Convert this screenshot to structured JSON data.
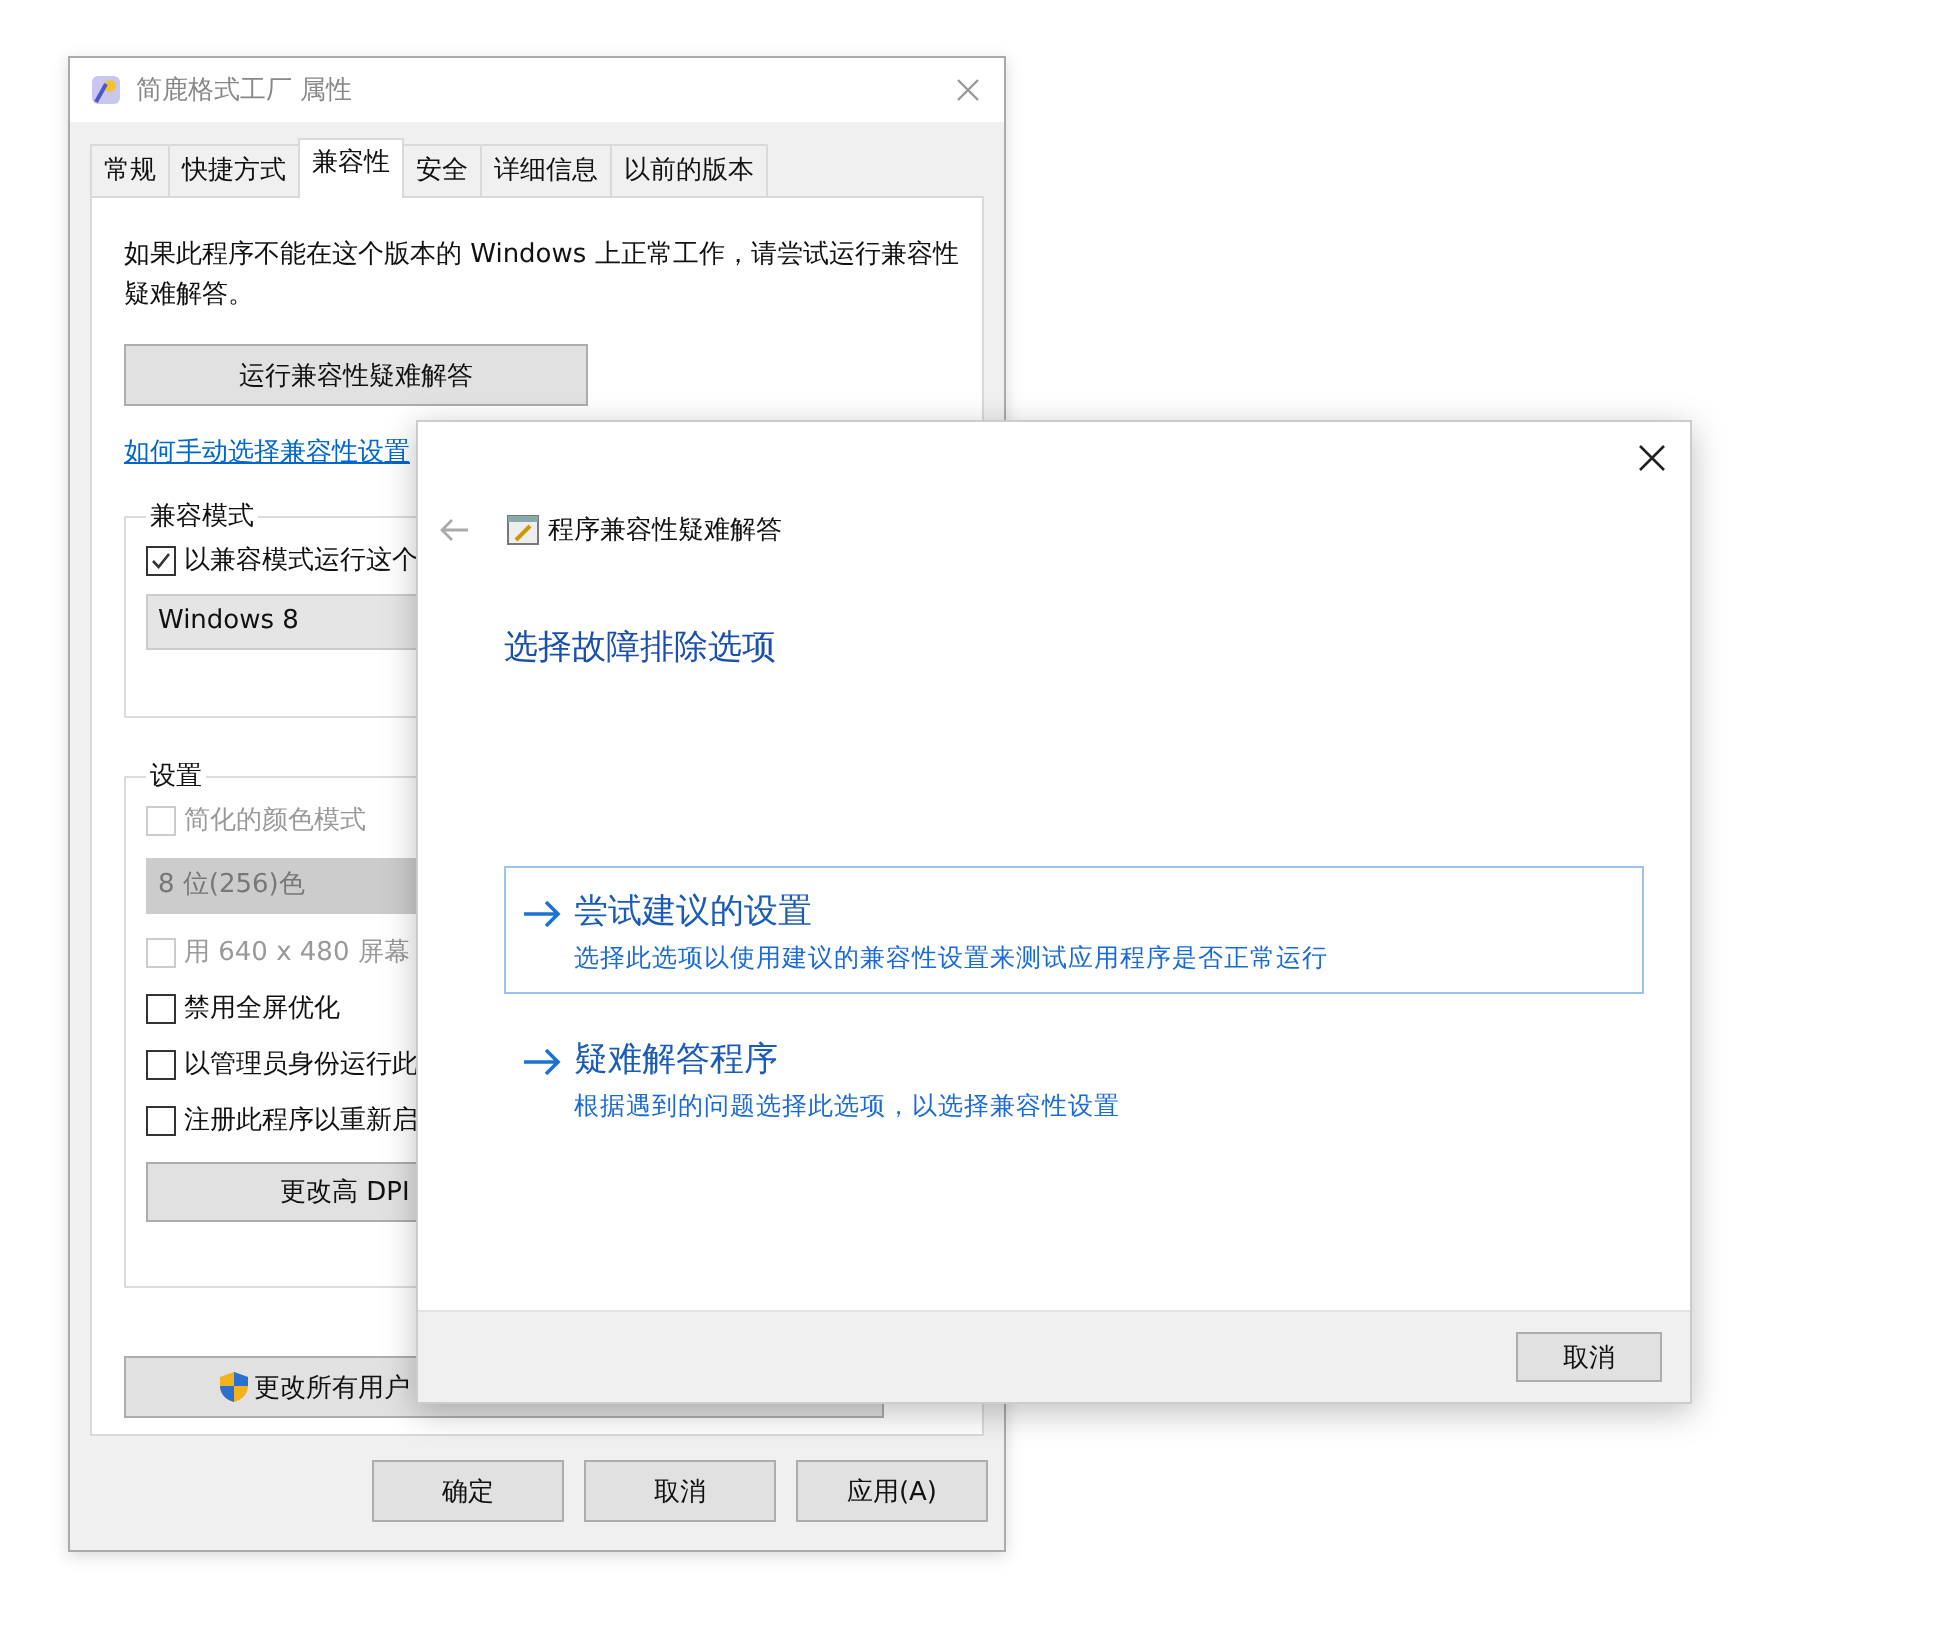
{
  "properties_window": {
    "title": "简鹿格式工厂 属性",
    "tabs": [
      {
        "label": "常规",
        "selected": false
      },
      {
        "label": "快捷方式",
        "selected": false
      },
      {
        "label": "兼容性",
        "selected": true
      },
      {
        "label": "安全",
        "selected": false
      },
      {
        "label": "详细信息",
        "selected": false
      },
      {
        "label": "以前的版本",
        "selected": false
      }
    ],
    "intro": "如果此程序不能在这个版本的 Windows 上正常工作，请尝试运行兼容性疑难解答。",
    "troubleshoot_button": "运行兼容性疑难解答",
    "manual_link": "如何手动选择兼容性设置",
    "compat_group": {
      "label": "兼容模式",
      "checkbox": {
        "label": "以兼容模式运行这个",
        "checked": true
      },
      "dropdown": {
        "value": "Windows 8"
      }
    },
    "settings_group": {
      "label": "设置",
      "items": [
        {
          "kind": "checkbox",
          "label": "简化的颜色模式",
          "checked": false,
          "disabled": true
        },
        {
          "kind": "dropdown",
          "value": "8 位(256)色",
          "disabled": true
        },
        {
          "kind": "checkbox",
          "label": "用 640 x 480 屏幕",
          "checked": false,
          "disabled": true
        },
        {
          "kind": "checkbox",
          "label": "禁用全屏优化",
          "checked": false,
          "disabled": false
        },
        {
          "kind": "checkbox",
          "label": "以管理员身份运行此",
          "checked": false,
          "disabled": false
        },
        {
          "kind": "checkbox",
          "label": "注册此程序以重新启",
          "checked": false,
          "disabled": false
        },
        {
          "kind": "button",
          "label": "更改高 DPI"
        }
      ]
    },
    "all_users_button": "更改所有用户",
    "buttons": [
      "确定",
      "取消",
      "应用(A)"
    ]
  },
  "troubleshooter": {
    "title": "程序兼容性疑难解答",
    "heading": "选择故障排除选项",
    "options": [
      {
        "title": "尝试建议的设置",
        "description": "选择此选项以使用建议的兼容性设置来测试应用程序是否正常运行",
        "selected": true
      },
      {
        "title": "疑难解答程序",
        "description": "根据遇到的问题选择此选项，以选择兼容性设置",
        "selected": false
      }
    ],
    "cancel_button": "取消"
  }
}
